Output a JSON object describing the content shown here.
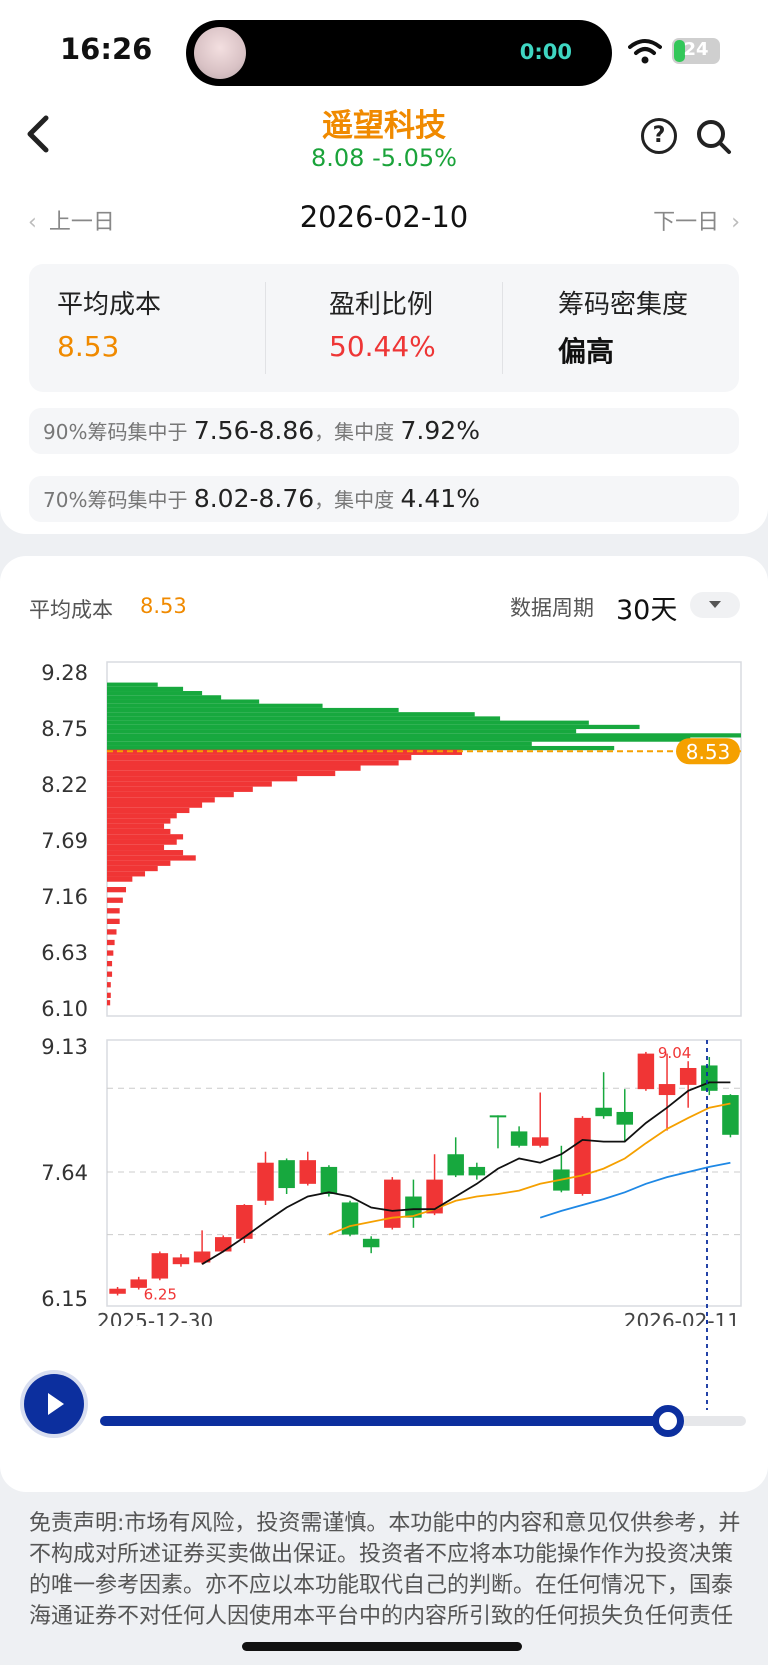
{
  "status_bar": {
    "time": "16:26",
    "island_timer": "0:00",
    "battery": "24",
    "battery_level": 0.24
  },
  "header": {
    "stock_name": "遥望科技",
    "price_change": "8.08 -5.05%",
    "help_label": "?"
  },
  "date_nav": {
    "prev_label": "上一日",
    "current_date": "2026-02-10",
    "next_label": "下一日"
  },
  "stats": [
    {
      "label": "平均成本",
      "value": "8.53",
      "color": "#f08a00"
    },
    {
      "label": "盈利比例",
      "value": "50.44%",
      "color": "#ee3636"
    },
    {
      "label": "筹码密集度",
      "value": "偏高",
      "color": "#111111"
    }
  ],
  "concentration": [
    {
      "pct": "90%",
      "prefix": "筹码集中于",
      "range": "7.56-8.86",
      "sep": "，集中度",
      "degree": "7.92%"
    },
    {
      "pct": "70%",
      "prefix": "筹码集中于",
      "range": "8.02-8.76",
      "sep": "，集中度",
      "degree": "4.41%"
    }
  ],
  "chart_header": {
    "avg_label": "平均成本",
    "avg_value": "8.53",
    "period_label": "数据周期",
    "period_value": "30天"
  },
  "colors": {
    "up": "#f03535",
    "down": "#17a83e",
    "avg_cost": "#f5a000",
    "ma_short": "#111111",
    "ma_mid": "#f5a000",
    "ma_long": "#1e88e5",
    "accent": "#0c2f9e"
  },
  "chart_data": [
    {
      "type": "bar",
      "orientation": "horizontal",
      "title": "",
      "y_ticks": [
        "9.28",
        "8.75",
        "8.22",
        "7.69",
        "7.16",
        "6.63",
        "6.10"
      ],
      "ylim": [
        6.1,
        9.28
      ],
      "avg_cost": 8.53,
      "avg_cost_label": "8.53",
      "profit_series": {
        "name": "",
        "color": "#17a83e",
        "prices": [
          9.16,
          9.12,
          9.08,
          9.04,
          9.0,
          8.96,
          8.92,
          8.88,
          8.84,
          8.8,
          8.76,
          8.72,
          8.68,
          8.64,
          8.6,
          8.56
        ],
        "widths": [
          0.08,
          0.12,
          0.15,
          0.18,
          0.24,
          0.34,
          0.46,
          0.58,
          0.62,
          0.76,
          0.84,
          0.74,
          1.0,
          0.92,
          0.67,
          0.8
        ]
      },
      "loss_series": {
        "name": "",
        "color": "#f03535",
        "prices": [
          8.52,
          8.47,
          8.42,
          8.37,
          8.32,
          8.27,
          8.22,
          8.17,
          8.12,
          8.07,
          8.02,
          7.97,
          7.92,
          7.87,
          7.82,
          7.77,
          7.72,
          7.67,
          7.62,
          7.57,
          7.52,
          7.47,
          7.42,
          7.37,
          7.32,
          7.22,
          7.12,
          7.02,
          6.92,
          6.82,
          6.72,
          6.62,
          6.52,
          6.42,
          6.32,
          6.22,
          6.15
        ],
        "widths": [
          0.56,
          0.48,
          0.46,
          0.4,
          0.36,
          0.3,
          0.26,
          0.23,
          0.2,
          0.17,
          0.15,
          0.13,
          0.11,
          0.1,
          0.09,
          0.1,
          0.12,
          0.11,
          0.09,
          0.12,
          0.14,
          0.1,
          0.08,
          0.06,
          0.04,
          0.03,
          0.025,
          0.02,
          0.02,
          0.015,
          0.012,
          0.01,
          0.008,
          0.008,
          0.006,
          0.006,
          0.005
        ]
      }
    },
    {
      "type": "candlestick",
      "title": "",
      "y_ticks": [
        "9.13",
        "7.64",
        "6.15"
      ],
      "ylim": [
        6.15,
        9.13
      ],
      "x_labels": [
        "2025-12-30",
        "2026-02-11"
      ],
      "high_label": "9.04",
      "low_label": "6.25",
      "candles": [
        {
          "o": 6.2,
          "c": 6.26,
          "h": 6.28,
          "l": 6.18
        },
        {
          "o": 6.27,
          "c": 6.37,
          "h": 6.4,
          "l": 6.25
        },
        {
          "o": 6.38,
          "c": 6.68,
          "h": 6.7,
          "l": 6.36
        },
        {
          "o": 6.55,
          "c": 6.63,
          "h": 6.67,
          "l": 6.52
        },
        {
          "o": 6.57,
          "c": 6.7,
          "h": 6.95,
          "l": 6.55
        },
        {
          "o": 6.7,
          "c": 6.87,
          "h": 6.89,
          "l": 6.69
        },
        {
          "o": 6.85,
          "c": 7.25,
          "h": 7.26,
          "l": 6.8
        },
        {
          "o": 7.3,
          "c": 7.75,
          "h": 7.88,
          "l": 7.25
        },
        {
          "o": 7.78,
          "c": 7.45,
          "h": 7.8,
          "l": 7.38
        },
        {
          "o": 7.5,
          "c": 7.78,
          "h": 7.88,
          "l": 7.48
        },
        {
          "o": 7.7,
          "c": 7.38,
          "h": 7.72,
          "l": 7.35
        },
        {
          "o": 7.28,
          "c": 6.9,
          "h": 7.3,
          "l": 6.88
        },
        {
          "o": 6.85,
          "c": 6.75,
          "h": 6.88,
          "l": 6.68
        },
        {
          "o": 6.98,
          "c": 7.55,
          "h": 7.58,
          "l": 6.96
        },
        {
          "o": 7.35,
          "c": 7.1,
          "h": 7.55,
          "l": 6.98
        },
        {
          "o": 7.15,
          "c": 7.55,
          "h": 7.85,
          "l": 7.13
        },
        {
          "o": 7.85,
          "c": 7.6,
          "h": 8.05,
          "l": 7.58
        },
        {
          "o": 7.7,
          "c": 7.6,
          "h": 7.75,
          "l": 7.55
        },
        {
          "o": 8.31,
          "c": 8.3,
          "h": 8.31,
          "l": 7.92
        },
        {
          "o": 8.12,
          "c": 7.95,
          "h": 8.18,
          "l": 7.93
        },
        {
          "o": 7.95,
          "c": 8.05,
          "h": 8.58,
          "l": 7.93
        },
        {
          "o": 7.67,
          "c": 7.42,
          "h": 7.95,
          "l": 7.4
        },
        {
          "o": 7.38,
          "c": 8.28,
          "h": 8.3,
          "l": 7.36
        },
        {
          "o": 8.4,
          "c": 8.3,
          "h": 8.82,
          "l": 8.27
        },
        {
          "o": 8.35,
          "c": 8.2,
          "h": 8.62,
          "l": 8.0
        },
        {
          "o": 8.62,
          "c": 9.04,
          "h": 9.06,
          "l": 8.6
        },
        {
          "o": 8.55,
          "c": 8.68,
          "h": 9.04,
          "l": 8.13
        },
        {
          "o": 8.67,
          "c": 8.87,
          "h": 8.95,
          "l": 8.4
        },
        {
          "o": 8.9,
          "c": 8.6,
          "h": 9.0,
          "l": 8.55
        },
        {
          "o": 8.55,
          "c": 8.08,
          "h": 8.56,
          "l": 8.05
        }
      ],
      "ma_short": {
        "name": "",
        "start": 4,
        "values": [
          6.55,
          6.7,
          6.87,
          7.05,
          7.22,
          7.35,
          7.4,
          7.35,
          7.22,
          7.18,
          7.2,
          7.2,
          7.35,
          7.5,
          7.68,
          7.8,
          7.75,
          7.85,
          8.02,
          8.0,
          8.0,
          8.22,
          8.4,
          8.6,
          8.7,
          8.7
        ]
      },
      "ma_mid": {
        "name": "",
        "start": 10,
        "values": [
          6.9,
          7.0,
          7.05,
          7.1,
          7.12,
          7.2,
          7.3,
          7.35,
          7.38,
          7.42,
          7.5,
          7.55,
          7.6,
          7.68,
          7.8,
          7.98,
          8.15,
          8.28,
          8.4,
          8.45
        ]
      },
      "ma_long": {
        "name": "",
        "start": 20,
        "values": [
          7.1,
          7.18,
          7.25,
          7.32,
          7.4,
          7.5,
          7.58,
          7.64,
          7.7,
          7.75
        ]
      }
    }
  ],
  "playback": {
    "progress": 0.88
  },
  "disclaimer": "免责声明:市场有风险，投资需谨慎。本功能中的内容和意见仅供参考，并不构成对所述证券买卖做出保证。投资者不应将本功能操作作为投资决策的唯一参考因素。亦不应以本功能取代自己的判断。在任何情况下，国泰海通证券不对任何人因使用本平台中的内容所引致的任何损失负任何责任"
}
